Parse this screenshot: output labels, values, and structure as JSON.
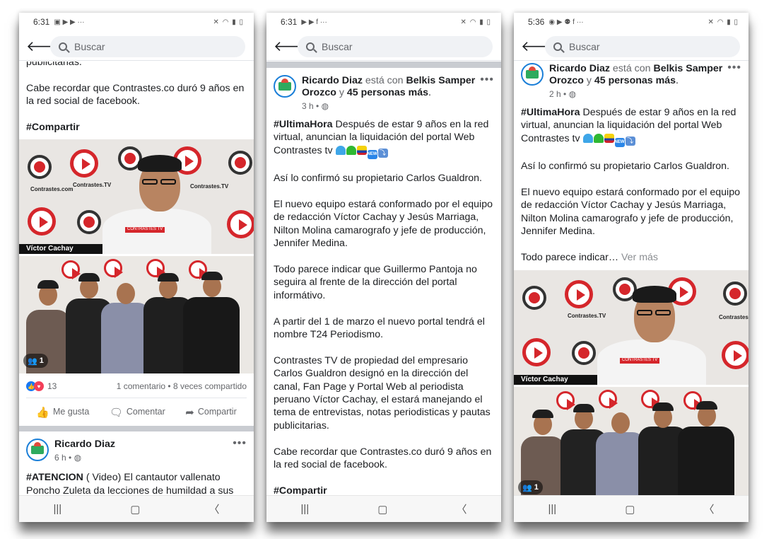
{
  "screens": [
    {
      "status": {
        "time": "6:31"
      },
      "search_placeholder": "Buscar",
      "post_tail": {
        "line1": "publicitarias.",
        "line2": "Cabe recordar que Contrastes.co duró 9 años en la red social de facebook.",
        "hashtag": "#Compartir"
      },
      "photo": {
        "caption": "Víctor Cachay",
        "brand1": "Contrastes.TV",
        "brand2": "Contrastes.TV",
        "brand3": "Contrastes.com",
        "badge": "1"
      },
      "reactions": {
        "count": "13",
        "stats": "1 comentario • 8 veces compartido"
      },
      "actions": {
        "like": "Me gusta",
        "comment": "Comentar",
        "share": "Compartir"
      },
      "next_post": {
        "author": "Ricardo Diaz",
        "time": "6 h •",
        "tag": "#ATENCION",
        "text": "( Video) El cantautor vallenato Poncho Zuleta da lecciones de humildad a sus"
      }
    },
    {
      "status": {
        "time": "6:31"
      },
      "search_placeholder": "Buscar",
      "post": {
        "author": "Ricardo Diaz",
        "with_word": "está con",
        "tagged": "Belkis Samper Orozco",
        "and_word": "y",
        "others": "45 personas más",
        "period": ".",
        "time": "3 h •",
        "hashtag": "#UltimaHora",
        "p1": "Después de estar 9 años en la red virtual, anuncian la liquidación del portal Web Contrastes tv",
        "p2": "Así lo confirmó su propietario Carlos Gualdron.",
        "p3": "El nuevo equipo estará conformado por el equipo de redacción Víctor Cachay y Jesús Marriaga, Nilton Molina camarografo y jefe de producción, Jennifer Medina.",
        "p4": "Todo parece indicar que Guillermo Pantoja no seguira al frente de la dirección del portal informátivo.",
        "p5": "A partir del 1 de marzo el nuevo portal tendrá el nombre T24 Periodismo.",
        "p6": "Contrastes TV de propiedad del empresario Carlos Gualdron designó en la dirección del canal, Fan Page y Portal Web al periodista peruano Víctor Cachay, el estará manejando el tema de entrevistas, notas periodisticas y pautas publicitarias.",
        "p7": "Cabe recordar que Contrastes.co duró 9 años en la red social de facebook.",
        "tail_tag": "#Compartir"
      }
    },
    {
      "status": {
        "time": "5:36"
      },
      "search_placeholder": "Buscar",
      "post": {
        "author": "Ricardo Diaz",
        "with_word": "está con",
        "tagged": "Belkis Samper Orozco",
        "and_word": "y",
        "others": "45 personas más",
        "period": ".",
        "time": "2 h •",
        "hashtag": "#UltimaHora",
        "p1": "Después de estar 9 años en la red virtual, anuncian la liquidación del portal Web Contrastes tv",
        "p2": "Así lo confirmó su propietario Carlos Gualdron.",
        "p3": "El nuevo equipo estará conformado por el equipo de redacción Víctor Cachay y Jesús Marriaga, Nilton Molina camarografo y jefe de producción, Jennifer Medina.",
        "p4": "Todo parece indicar…",
        "see_more": "Ver más"
      },
      "photo": {
        "caption": "Víctor Cachay",
        "brand1": "Contrastes.TV",
        "brand2": "Contrastes",
        "badge": "1"
      }
    }
  ]
}
